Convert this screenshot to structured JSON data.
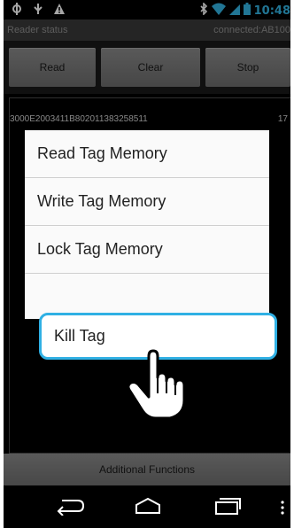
{
  "status_bar": {
    "time": "10:48",
    "left_icons": [
      "usb-icon",
      "android-debug-icon",
      "warning-icon"
    ],
    "right_icons": [
      "bluetooth-icon",
      "wifi-icon",
      "signal-icon",
      "battery-icon"
    ],
    "accent_color": "#33b5e5"
  },
  "reader": {
    "status_label": "Reader status",
    "connection": "connected:AB100"
  },
  "toolbar": {
    "read_label": "Read",
    "clear_label": "Clear",
    "stop_label": "Stop"
  },
  "tags": [
    {
      "epc": "3000E2003411B802011383258511",
      "count": "17"
    }
  ],
  "context_menu": {
    "items": [
      "Read Tag Memory",
      "Write Tag Memory",
      "Lock Tag Memory",
      "Kill Tag"
    ],
    "highlight_color": "#2fb0e4"
  },
  "footer": {
    "additional_label": "Additional Functions"
  },
  "nav": {
    "icons": [
      "back-icon",
      "home-icon",
      "recents-icon",
      "menu-icon"
    ]
  }
}
